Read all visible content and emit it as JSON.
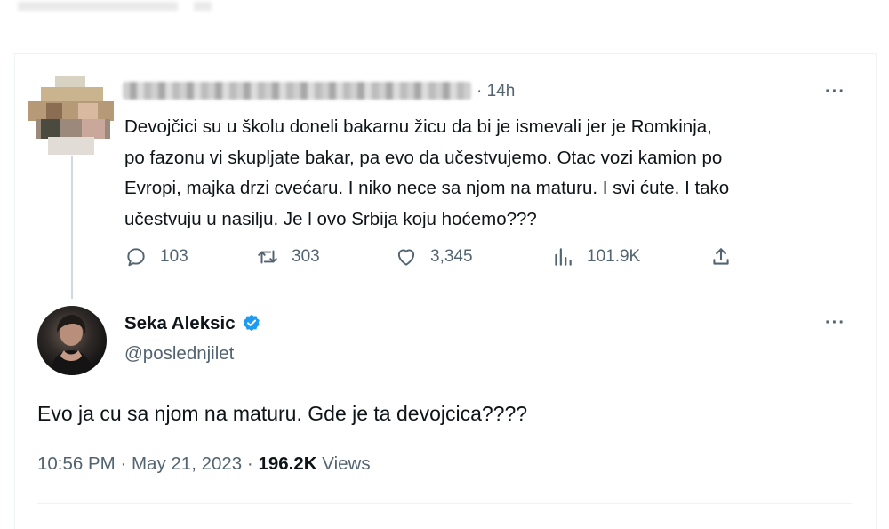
{
  "reply": {
    "time": "· 14h",
    "text_lines": [
      "Devojčici su u školu doneli bakarnu žicu da bi je ismevali jer je Romkinja,",
      "po fazonu vi skupljate bakar, pa evo da učestvujemo. Otac vozi kamion po",
      "Evropi, majka drzi cvećaru. I niko nece sa njom na maturu. I svi ćute. I tako",
      "učestvuju u nasilju. Je l ovo Srbija koju hoćemo???"
    ],
    "actions": {
      "replies": "103",
      "reposts": "303",
      "likes": "3,345",
      "views": "101.9K"
    },
    "more_label": "···"
  },
  "main": {
    "display_name": "Seka Aleksic",
    "handle": "@poslednjilet",
    "more_label": "···",
    "text": "Evo ja cu sa njom na maturu. Gde je ta devojcica????",
    "time": "10:56 PM",
    "date": "May 21, 2023",
    "views_count": "196.2K",
    "views_label": "Views",
    "separator": "·"
  },
  "colors": {
    "text": "#0f1419",
    "secondary": "#536471",
    "verified": "#1d9bf0",
    "line": "#cfd9de"
  },
  "icons": [
    "reply-icon",
    "repost-icon",
    "like-icon",
    "views-icon",
    "share-icon",
    "verified-icon",
    "more-icon"
  ]
}
